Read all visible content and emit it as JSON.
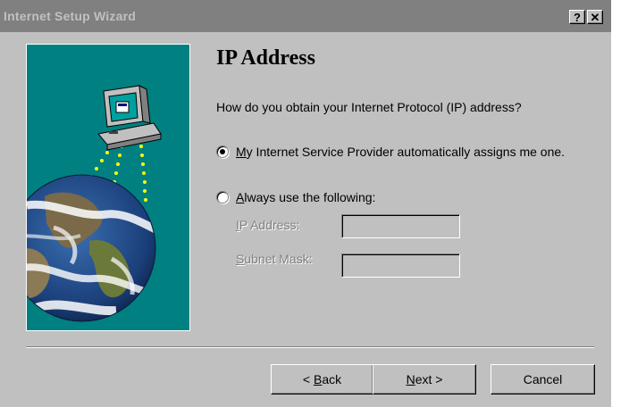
{
  "window": {
    "title": "Internet Setup Wizard",
    "help_label": "?",
    "close_label": "✕"
  },
  "page": {
    "heading": "IP Address",
    "question": "How do you obtain your Internet Protocol (IP) address?",
    "option_auto": {
      "mnemonic": "M",
      "rest": "y Internet Service Provider automatically assigns me one.",
      "selected": true
    },
    "option_manual": {
      "mnemonic": "A",
      "rest": "lways use the following:",
      "selected": false
    },
    "ip_field": {
      "mnemonic": "I",
      "rest": "P Address:",
      "value": ""
    },
    "subnet_field": {
      "mnemonic": "S",
      "rest": "ubnet Mask:",
      "value": ""
    }
  },
  "buttons": {
    "back": {
      "prefix": "< ",
      "mnemonic": "B",
      "rest": "ack"
    },
    "next": {
      "mnemonic": "N",
      "rest": "ext >"
    },
    "cancel": "Cancel"
  },
  "illustration": {
    "icons": [
      "computer-icon",
      "globe-icon"
    ],
    "background_color": "#008080"
  }
}
